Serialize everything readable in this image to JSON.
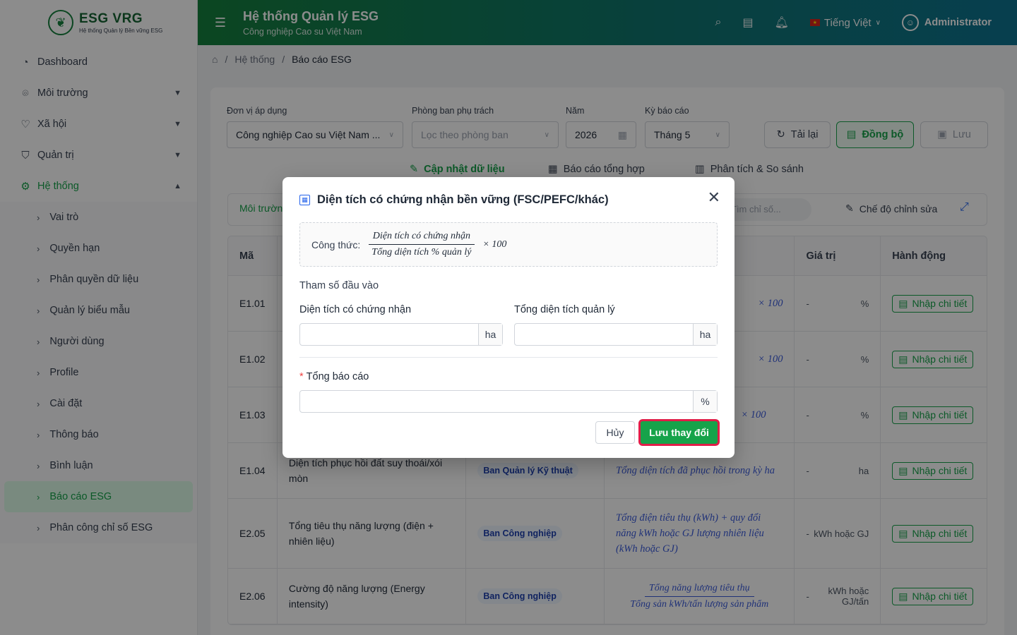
{
  "brand": {
    "name": "ESG VRG",
    "tagline": "Hệ thống Quản lý Bền vững ESG"
  },
  "sidebar": {
    "items": [
      {
        "label": "Dashboard",
        "icon": "dashboard-icon"
      },
      {
        "label": "Môi trường",
        "icon": "location-icon"
      },
      {
        "label": "Xã hội",
        "icon": "heart-icon"
      },
      {
        "label": "Quản trị",
        "icon": "shield-icon"
      },
      {
        "label": "Hệ thống",
        "icon": "gear-icon"
      }
    ],
    "subitems": [
      {
        "label": "Vai trò"
      },
      {
        "label": "Quyền hạn"
      },
      {
        "label": "Phân quyền dữ liệu"
      },
      {
        "label": "Quản lý biểu mẫu"
      },
      {
        "label": "Người dùng"
      },
      {
        "label": "Profile"
      },
      {
        "label": "Cài đặt"
      },
      {
        "label": "Thông báo"
      },
      {
        "label": "Bình luận"
      },
      {
        "label": "Báo cáo ESG"
      },
      {
        "label": "Phân công chỉ số ESG"
      }
    ]
  },
  "header": {
    "title": "Hệ thống Quản lý ESG",
    "subtitle": "Công nghiệp Cao su Việt Nam",
    "language": "Tiếng Việt",
    "user": "Administrator"
  },
  "breadcrumb": {
    "level1": "Hệ thống",
    "level2": "Báo cáo ESG"
  },
  "filters": {
    "unit_label": "Đơn vị áp dụng",
    "unit_value": "Công nghiệp Cao su Việt Nam ...",
    "dept_label": "Phòng ban phụ trách",
    "dept_placeholder": "Lọc theo phòng ban",
    "year_label": "Năm",
    "year_value": "2026",
    "period_label": "Kỳ báo cáo",
    "period_value": "Tháng 5"
  },
  "actions": {
    "reload": "Tải lại",
    "sync": "Đồng bộ",
    "save": "Lưu"
  },
  "tabs": [
    "Cập nhật dữ liệu",
    "Báo cáo tổng hợp",
    "Phân tích & So sánh"
  ],
  "toolbar": {
    "chip": "Môi trường",
    "search_placeholder": "Tìm chỉ số...",
    "edit_mode": "Chế độ chỉnh sửa"
  },
  "table": {
    "headers": {
      "code": "Mã",
      "value": "Giá trị",
      "action": "Hành động"
    },
    "action_label": "Nhập chi tiết",
    "rows": [
      {
        "code": "E1.01",
        "name": "",
        "dept": "",
        "formula": "× 100",
        "value": "-",
        "unit": "%"
      },
      {
        "code": "E1.02",
        "name": "",
        "dept": "",
        "formula": "× 100",
        "value": "-",
        "unit": "%"
      },
      {
        "code": "E1.03",
        "name": "",
        "dept": "",
        "formula": "× 100",
        "value": "-",
        "unit": "%"
      },
      {
        "code": "E1.04",
        "name": "Diện tích phục hồi đất suy thoái/xói mòn",
        "dept": "Ban Quản lý Kỹ thuật",
        "formula": "Tổng diện tích đã phục hồi trong kỳ ha",
        "value": "-",
        "unit": "ha"
      },
      {
        "code": "E2.05",
        "name": "Tổng tiêu thụ năng lượng (điện + nhiên liệu)",
        "dept": "Ban Công nghiệp",
        "formula": "Tổng điện tiêu thụ (kWh) + quy đổi năng kWh hoặc GJ lượng nhiên liệu (kWh hoặc GJ)",
        "value": "-",
        "unit": "kWh hoặc GJ"
      },
      {
        "code": "E2.06",
        "name": "Cường độ năng lượng (Energy intensity)",
        "dept": "Ban Công nghiệp",
        "formula_num": "Tổng năng lượng tiêu thụ",
        "formula_den": "Tổng sản kWh/tấn lượng sản phẩm",
        "value": "-",
        "unit": "kWh hoặc GJ/tấn"
      }
    ]
  },
  "modal": {
    "title": "Diện tích có chứng nhận bền vững (FSC/PEFC/khác)",
    "formula_label": "Công thức:",
    "formula_num": "Diện tích có chứng nhận",
    "formula_den": "Tổng diện tích % quản lý",
    "formula_mult": "× 100",
    "section": "Tham số đầu vào",
    "field1_label": "Diện tích có chứng nhận",
    "field1_unit": "ha",
    "field2_label": "Tổng diện tích quản lý",
    "field2_unit": "ha",
    "total_label": "Tổng báo cáo",
    "total_unit": "%",
    "cancel": "Hủy",
    "save": "Lưu thay đổi"
  }
}
